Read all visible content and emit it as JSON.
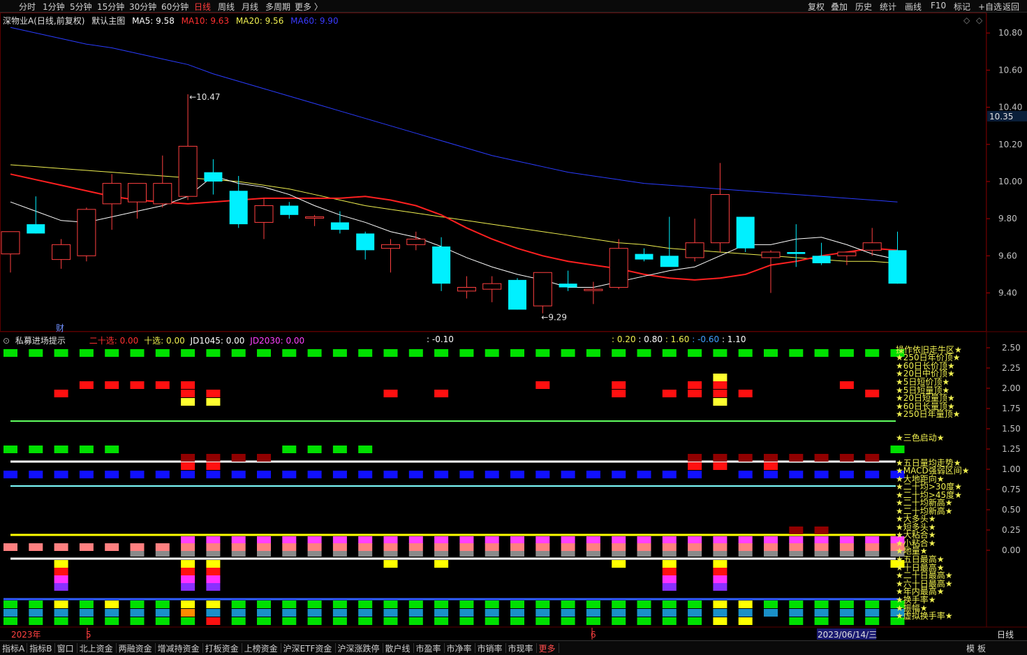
{
  "toolbar": {
    "periods": [
      "分时",
      "1分钟",
      "5分钟",
      "15分钟",
      "30分钟",
      "60分钟",
      "日线",
      "周线",
      "月线",
      "多周期",
      "更多 〉"
    ],
    "active_period": "日线",
    "right_buttons": [
      "复权",
      "叠加",
      "历史",
      "统计",
      "画线",
      "F10",
      "标记",
      "+自选",
      "返回"
    ]
  },
  "main_info": {
    "stock": "深物业A(日线,前复权)",
    "template": "默认主图",
    "ma5": "MA5: 9.58",
    "ma10": "MA10: 9.63",
    "ma20": "MA20: 9.56",
    "ma60": "MA60: 9.90",
    "colors": {
      "ma5": "#ffffff",
      "ma10": "#ff3030",
      "ma20": "#f0f050",
      "ma60": "#3030ff"
    }
  },
  "price_axis": {
    "labels": [
      "10.80",
      "10.60",
      "10.40",
      "10.20",
      "10.00",
      "9.80",
      "9.60",
      "9.40"
    ],
    "current": "10.35"
  },
  "annotations": {
    "high": "10.47",
    "low": "9.29",
    "cai": "财"
  },
  "sub_info": {
    "name": "私募进场提示",
    "v1": "二十选: 0.00",
    "v2": "十选: 0.00",
    "v3": "JD1045: 0.00",
    "v4": "JD2030: 0.00",
    "v5": ": -0.10",
    "v6": ": 0.20",
    "v7": ": 0.80",
    "v8": ": 1.60",
    "v9": ": -0.60",
    "v10": ": 1.10"
  },
  "sub_axis": [
    "2.50",
    "2.25",
    "2.00",
    "1.75",
    "1.50",
    "1.25",
    "1.00",
    "0.75",
    "0.50",
    "0.25",
    "0.00"
  ],
  "sub_labels": [
    "操作依旧走牛区★",
    "★250日年价顶★",
    "★60日长价顶★",
    "★20日中价顶★",
    "★5日短价顶★",
    "★5日短量顶★",
    "★20日短量顶★",
    "★60日长量顶★",
    "★250日年量顶★",
    "★三色启动★",
    "★五日量均走势★",
    "★MACD强弱区间★",
    "★大地距向★",
    "★二十均>30度★",
    "★二十均>45度★",
    "★二十均新高★",
    "★二十均新高★",
    "★大多头★",
    "★短多头★",
    "★大粘合★",
    "★小粘合★",
    "★地量★",
    "★五日最高★",
    "★十日最高★",
    "★二十日最高★",
    "★六十日最高★",
    "★年内最高★",
    "★换手率★",
    "★振幅★",
    "★虚拟换手率★"
  ],
  "date_axis": {
    "year": "2023年",
    "m5": "5",
    "m6": "6",
    "cursor": "2023/06/14/三",
    "period": "日线"
  },
  "bottom_tabs": [
    "指标A",
    "指标B",
    "窗口",
    "北上资金",
    "两融资金",
    "增减持资金",
    "打板资金",
    "上榜资金",
    "沪深ETF资金",
    "沪深涨跌停",
    "散户线",
    "市盈率",
    "市净率",
    "市销率",
    "市现率",
    "更多"
  ],
  "bottom_right": [
    "模",
    "板"
  ],
  "chart_data": {
    "type": "candlestick",
    "price_range": [
      9.21,
      10.91
    ],
    "candles": [
      {
        "o": 9.61,
        "h": 9.68,
        "l": 9.51,
        "c": 9.73
      },
      {
        "o": 9.77,
        "h": 9.92,
        "l": 9.72,
        "c": 9.72
      },
      {
        "o": 9.58,
        "h": 9.69,
        "l": 9.53,
        "c": 9.66
      },
      {
        "o": 9.6,
        "h": 9.86,
        "l": 9.57,
        "c": 9.85
      },
      {
        "o": 9.88,
        "h": 10.04,
        "l": 9.74,
        "c": 9.99
      },
      {
        "o": 9.89,
        "h": 9.99,
        "l": 9.8,
        "c": 9.99
      },
      {
        "o": 9.88,
        "h": 10.14,
        "l": 9.86,
        "c": 9.99
      },
      {
        "o": 9.92,
        "h": 10.47,
        "l": 9.9,
        "c": 10.19
      },
      {
        "o": 10.05,
        "h": 10.12,
        "l": 9.93,
        "c": 10.0
      },
      {
        "o": 9.95,
        "h": 10.03,
        "l": 9.75,
        "c": 9.77
      },
      {
        "o": 9.78,
        "h": 9.91,
        "l": 9.69,
        "c": 9.87
      },
      {
        "o": 9.87,
        "h": 9.89,
        "l": 9.8,
        "c": 9.82
      },
      {
        "o": 9.81,
        "h": 9.82,
        "l": 9.76,
        "c": 9.81
      },
      {
        "o": 9.78,
        "h": 9.84,
        "l": 9.72,
        "c": 9.74
      },
      {
        "o": 9.72,
        "h": 9.73,
        "l": 9.58,
        "c": 9.63
      },
      {
        "o": 9.64,
        "h": 9.69,
        "l": 9.51,
        "c": 9.66
      },
      {
        "o": 9.66,
        "h": 9.73,
        "l": 9.63,
        "c": 9.69
      },
      {
        "o": 9.65,
        "h": 9.7,
        "l": 9.41,
        "c": 9.45
      },
      {
        "o": 9.41,
        "h": 9.49,
        "l": 9.37,
        "c": 9.43
      },
      {
        "o": 9.42,
        "h": 9.49,
        "l": 9.35,
        "c": 9.45
      },
      {
        "o": 9.47,
        "h": 9.48,
        "l": 9.31,
        "c": 9.31
      },
      {
        "o": 9.33,
        "h": 9.51,
        "l": 9.29,
        "c": 9.51
      },
      {
        "o": 9.45,
        "h": 9.52,
        "l": 9.41,
        "c": 9.43
      },
      {
        "o": 9.42,
        "h": 9.46,
        "l": 9.34,
        "c": 9.42
      },
      {
        "o": 9.43,
        "h": 9.69,
        "l": 9.42,
        "c": 9.64
      },
      {
        "o": 9.61,
        "h": 9.64,
        "l": 9.57,
        "c": 9.58
      },
      {
        "o": 9.6,
        "h": 9.81,
        "l": 9.57,
        "c": 9.54
      },
      {
        "o": 9.59,
        "h": 9.8,
        "l": 9.57,
        "c": 9.67
      },
      {
        "o": 9.67,
        "h": 10.1,
        "l": 9.62,
        "c": 9.93
      },
      {
        "o": 9.81,
        "h": 9.81,
        "l": 9.62,
        "c": 9.64
      },
      {
        "o": 9.59,
        "h": 9.63,
        "l": 9.4,
        "c": 9.62
      },
      {
        "o": 9.62,
        "h": 9.77,
        "l": 9.54,
        "c": 9.61
      },
      {
        "o": 9.6,
        "h": 9.67,
        "l": 9.55,
        "c": 9.56
      },
      {
        "o": 9.6,
        "h": 9.62,
        "l": 9.55,
        "c": 9.62
      },
      {
        "o": 9.63,
        "h": 9.75,
        "l": 9.6,
        "c": 9.67
      },
      {
        "o": 9.63,
        "h": 9.73,
        "l": 9.45,
        "c": 9.45
      }
    ],
    "ma5": [
      9.89,
      9.84,
      9.79,
      9.78,
      9.81,
      9.84,
      9.87,
      9.92,
      10.03,
      9.99,
      9.97,
      9.93,
      9.87,
      9.82,
      9.78,
      9.73,
      9.7,
      9.65,
      9.59,
      9.54,
      9.5,
      9.47,
      9.43,
      9.43,
      9.46,
      9.49,
      9.52,
      9.54,
      9.6,
      9.66,
      9.66,
      9.69,
      9.7,
      9.66,
      9.61,
      9.58
    ],
    "ma10": [
      10.04,
      10.01,
      9.98,
      9.95,
      9.92,
      9.9,
      9.89,
      9.88,
      9.89,
      9.9,
      9.91,
      9.91,
      9.91,
      9.91,
      9.92,
      9.9,
      9.87,
      9.82,
      9.75,
      9.69,
      9.64,
      9.6,
      9.57,
      9.55,
      9.53,
      9.5,
      9.48,
      9.47,
      9.48,
      9.5,
      9.55,
      9.57,
      9.6,
      9.62,
      9.64,
      9.63
    ],
    "ma20": [
      10.09,
      10.08,
      10.07,
      10.06,
      10.05,
      10.04,
      10.03,
      10.02,
      10.01,
      10.0,
      9.98,
      9.96,
      9.93,
      9.9,
      9.87,
      9.85,
      9.83,
      9.81,
      9.79,
      9.77,
      9.75,
      9.73,
      9.71,
      9.69,
      9.67,
      9.66,
      9.64,
      9.63,
      9.62,
      9.61,
      9.6,
      9.59,
      9.58,
      9.57,
      9.57,
      9.56
    ],
    "ma60": [
      10.83,
      10.8,
      10.77,
      10.74,
      10.72,
      10.69,
      10.66,
      10.63,
      10.58,
      10.54,
      10.5,
      10.46,
      10.42,
      10.38,
      10.34,
      10.3,
      10.26,
      10.22,
      10.18,
      10.14,
      10.11,
      10.08,
      10.05,
      10.03,
      10.01,
      9.99,
      9.98,
      9.97,
      9.96,
      9.95,
      9.94,
      9.93,
      9.92,
      9.91,
      9.9,
      9.89
    ]
  }
}
